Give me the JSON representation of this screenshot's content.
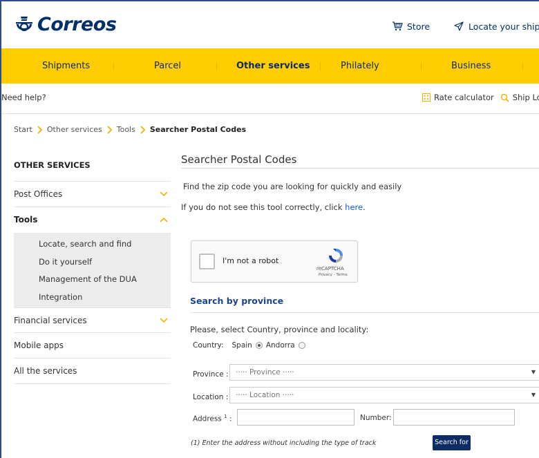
{
  "brand": {
    "name": "Correos",
    "color": "#002f6c",
    "accent": "#ffcd00"
  },
  "top_links": {
    "store": "Store",
    "locate": "Locate your ship"
  },
  "nav": [
    "Shipments",
    "Parcel",
    "Other services",
    "Philately",
    "Business"
  ],
  "nav_active": "Other services",
  "helpbar": {
    "need_help": "Need help?",
    "rate_calculator": "Rate calculator",
    "ship_locator": "Ship Loca"
  },
  "breadcrumb": {
    "start": "Start",
    "other_services": "Other services",
    "tools": "Tools",
    "current": "Searcher Postal Codes"
  },
  "sidebar": {
    "heading": "OTHER SERVICES",
    "post_offices": "Post Offices",
    "tools": "Tools",
    "tools_sub": [
      "Locate, search and find",
      "Do it yourself",
      "Management of the DUA",
      "Integration"
    ],
    "financial": "Financial services",
    "mobile": "Mobile apps",
    "all": "All the services"
  },
  "main": {
    "title": "Searcher Postal Codes",
    "intro": "Find the zip code you are looking for quickly and easily",
    "note_prefix": "If you do not see this tool correctly, click ",
    "note_link": "here",
    "note_suffix": "."
  },
  "captcha": {
    "label": "I'm not a robot",
    "brand": "reCAPTCHA",
    "terms": "Privacy - Terms"
  },
  "search_by_province": {
    "title": "Search by province",
    "instruction": "Please, select Country, province and locality:",
    "country_label": "Country:",
    "country_spain": "Spain",
    "country_andorra": "Andorra",
    "selected_country": "Spain",
    "province_label": "Province :",
    "province_placeholder": "····· Province ·····",
    "location_label": "Location :",
    "location_placeholder": "····· Location ·····",
    "address_label": "Address",
    "address_sup": "1",
    "address_colon": " :",
    "number_label": "Number:",
    "footnote": "(1) Enter the address without including the type of track",
    "search_button": "Search for"
  }
}
